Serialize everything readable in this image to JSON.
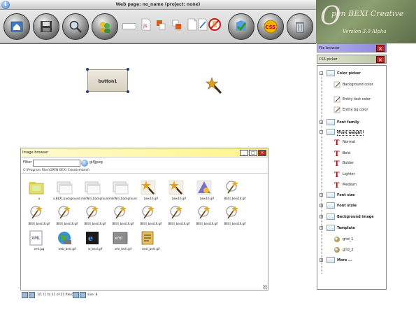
{
  "window": {
    "title": "Web page: no_name (project: none)"
  },
  "toolbar": {
    "buttons": [
      "home-icon",
      "save-icon",
      "search-icon",
      "users-icon",
      "js-icon",
      "layer-back-icon",
      "layer-front-icon",
      "page-icon",
      "edit-icon",
      "no-icon",
      "validate-icon",
      "css-icon",
      "trash-icon"
    ],
    "css_label": "CSS",
    "js_label": "js"
  },
  "logo": {
    "letter": "O",
    "name": "pen BEXI Creative",
    "version": "Version 3.0 Alpha"
  },
  "canvas": {
    "button_label": "button1"
  },
  "image_browser": {
    "title": "Image browser",
    "filter_label": "Filter",
    "filter_value": "",
    "pattern": "gif|jpeg",
    "path": "C:\\Program Files\\OPEN BEXI Creative\\bexi\\",
    "files": [
      {
        "label": "a",
        "kind": "folder"
      },
      {
        "label": "a.BEXI_background.gif",
        "kind": "window"
      },
      {
        "label": "mdiWin_background_title.gif",
        "kind": "window"
      },
      {
        "label": "mdiWin_background_gif",
        "kind": "window"
      },
      {
        "label": "bexi16.gif",
        "kind": "wand"
      },
      {
        "label": "bexi16.gif",
        "kind": "wand"
      },
      {
        "label": "bexi16.gif",
        "kind": "shapes"
      },
      {
        "label": "BEXI_bexi16.gif",
        "kind": "wand2"
      },
      {
        "label": "BEXI_bexi16.gif",
        "kind": "wand2"
      },
      {
        "label": "BEXI_bexi16.gif",
        "kind": "wand2"
      },
      {
        "label": "BEXI_bexi16.gif",
        "kind": "wand2"
      },
      {
        "label": "BEXI_bexi16.gif",
        "kind": "wand2"
      },
      {
        "label": "BEXI_bexi16.gif",
        "kind": "wand2"
      },
      {
        "label": "BEXI_bexi16.gif",
        "kind": "wand2"
      },
      {
        "label": "BEXI_bexi16.gif",
        "kind": "wand2"
      },
      {
        "label": "BEXI_bexi16.gif",
        "kind": "wand2"
      },
      {
        "label": "xml.jpg",
        "kind": "xml"
      },
      {
        "label": "web_bexi.gif",
        "kind": "globe"
      },
      {
        "label": "ie_bexi.gif",
        "kind": "ie"
      },
      {
        "label": "xml_bexi.gif",
        "kind": "xml2"
      },
      {
        "label": "bexi_bexi.gif",
        "kind": "doc"
      }
    ]
  },
  "pager": {
    "text": "1/1 (1 to 21 of 21 files)",
    "size": "size: 8"
  },
  "panels": {
    "file_browser": "File browser",
    "css_picker": "CSS picker"
  },
  "css_tree": [
    {
      "label": "Color picker",
      "level": 0
    },
    {
      "label": "Background color",
      "level": 1
    },
    {
      "label": "Entity text color",
      "level": 1
    },
    {
      "label": "Entity bg color",
      "level": 1
    },
    {
      "label": "Font family",
      "level": 0
    },
    {
      "label": "Font weight",
      "level": 0
    },
    {
      "label": "Normal",
      "level": 1
    },
    {
      "label": "Bold",
      "level": 1
    },
    {
      "label": "Bolder",
      "level": 1
    },
    {
      "label": "Lighter",
      "level": 1
    },
    {
      "label": "Medium",
      "level": 1
    },
    {
      "label": "Font size",
      "level": 0
    },
    {
      "label": "Font style",
      "level": 0
    },
    {
      "label": "Background image",
      "level": 0
    },
    {
      "label": "Template",
      "level": 0
    },
    {
      "label": "grid_1",
      "level": 1
    },
    {
      "label": "grid_2",
      "level": 1
    },
    {
      "label": "More ...",
      "level": 0
    }
  ]
}
